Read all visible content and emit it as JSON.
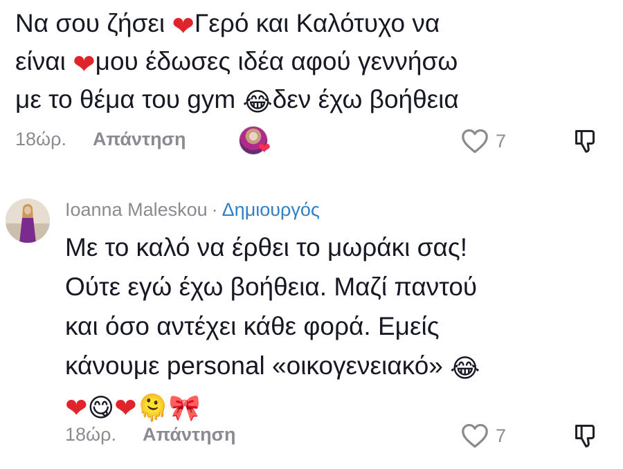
{
  "comment1": {
    "text_parts": [
      "Να σου ζήσει ",
      "Γερό και Καλότυχο να",
      "είναι ",
      "μου έδωσες ιδέα αφού γεννήσω",
      "με το θέμα του gym ",
      "δεν έχω βοήθεια"
    ],
    "emojis": {
      "heart": "❤",
      "laugh": "😂"
    },
    "time": "18ώρ.",
    "reply_label": "Απάντηση",
    "like_count": "7",
    "liked_by_creator": true
  },
  "comment2": {
    "author": "Ioanna Maleskou",
    "separator": "·",
    "badge": "Δημιουργός",
    "text_parts": [
      "Με το καλό να έρθει το μωράκι σας!",
      "Ούτε εγώ έχω βοήθεια. Μαζί παντού",
      "και όσο αντέχει κάθε φορά. Εμείς",
      "κάνουμε personal «οικογενειακό» "
    ],
    "emojis": {
      "laugh": "😂",
      "heart": "❤",
      "yum": "😋",
      "melt": "🫠",
      "bow": "🎀"
    },
    "time": "18ώρ.",
    "reply_label": "Απάντηση",
    "like_count": "7"
  },
  "colors": {
    "text": "#161823",
    "meta": "#8a8b91",
    "creator": "#2f80c8",
    "heart": "#e0242b"
  },
  "icons": [
    "heart-outline-icon",
    "dislike-icon",
    "heart-emoji",
    "laugh-emoji"
  ]
}
